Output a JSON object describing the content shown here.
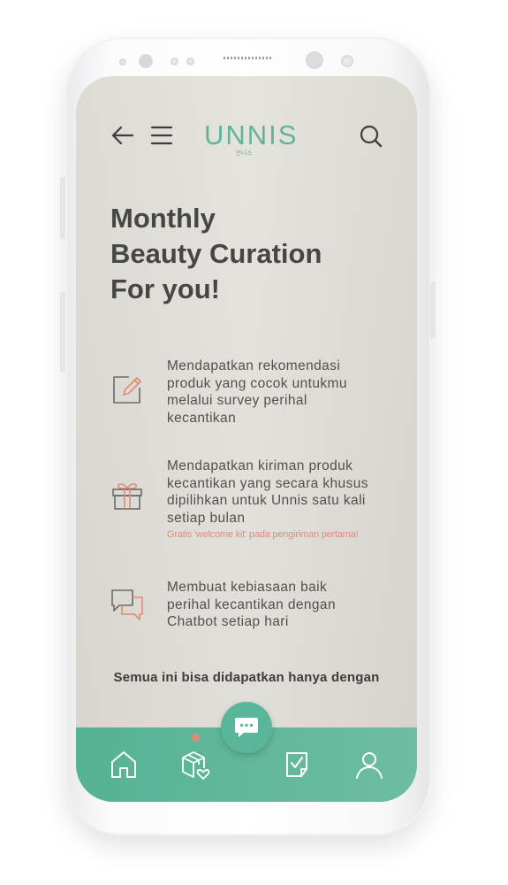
{
  "app": {
    "logo_text": "UNNIS",
    "logo_subtext": "언니스"
  },
  "header": {
    "icons": [
      "arrow-left-icon",
      "hamburger-menu-icon",
      "search-icon"
    ]
  },
  "headline": {
    "line1": "Monthly",
    "line2": "Beauty Curation",
    "line3": "For you!"
  },
  "features": [
    {
      "icon": "edit-pencil-icon",
      "lines": [
        "Mendapatkan rekomendasi",
        "produk yang cocok untukmu",
        "melalui survey perihal",
        "kecantikan"
      ]
    },
    {
      "icon": "gift-box-icon",
      "lines": [
        "Mendapatkan kiriman produk",
        "kecantikan yang secara khusus",
        "dipilihkan untuk Unnis satu kali",
        "setiap bulan"
      ],
      "note": "Gratis 'welcome kit' pada pengiriman pertama!"
    },
    {
      "icon": "chat-bubbles-icon",
      "lines": [
        "Membuat kebiasaan baik",
        "perihal kecantikan dengan",
        "Chatbot setiap hari"
      ]
    }
  ],
  "footer_text": "Semua ini bisa didapatkan hanya dengan",
  "bottom_nav": {
    "items": [
      "home-icon",
      "package-heart-icon",
      "chatbot-fab-icon",
      "checklist-icon",
      "profile-icon"
    ]
  },
  "colors": {
    "brand": "#5fb49b",
    "nav_bar": "#5ab394",
    "accent": "#e28a70",
    "text": "#464646"
  }
}
